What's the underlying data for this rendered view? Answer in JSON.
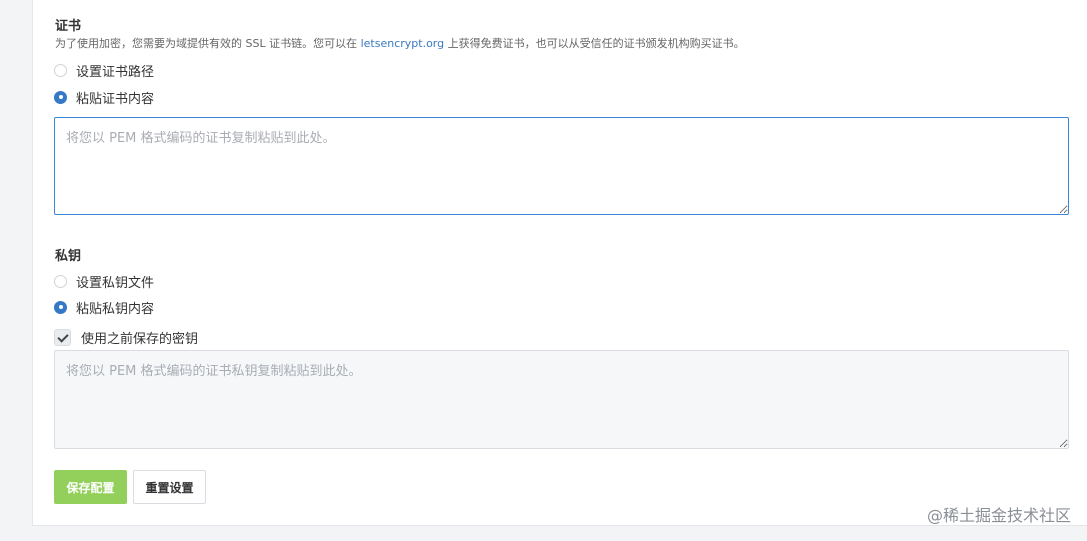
{
  "certificate": {
    "title": "证书",
    "hint_before": "为了使用加密，您需要为域提供有效的 SSL 证书链。您可以在 ",
    "hint_link": "letsencrypt.org",
    "hint_after": " 上获得免费证书，也可以从受信任的证书颁发机构购买证书。",
    "option_path": "设置证书路径",
    "option_paste": "粘贴证书内容",
    "selected": "paste",
    "textarea_value": "",
    "textarea_placeholder": "将您以 PEM 格式编码的证书复制粘贴到此处。"
  },
  "private_key": {
    "title": "私钥",
    "option_file": "设置私钥文件",
    "option_paste": "粘贴私钥内容",
    "selected": "paste",
    "use_saved_label": "使用之前保存的密钥",
    "use_saved_checked": true,
    "textarea_value": "",
    "textarea_placeholder": "将您以 PEM 格式编码的证书私钥复制粘贴到此处。"
  },
  "buttons": {
    "save_label": "保存配置",
    "reset_label": "重置设置"
  },
  "watermark": "@稀土掘金技术社区",
  "colors": {
    "accent": "#3478c6",
    "save_button": "#92d05b",
    "link": "#3a79c2"
  }
}
